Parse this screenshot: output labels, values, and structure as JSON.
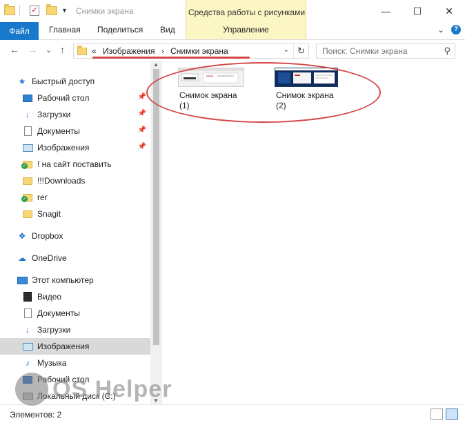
{
  "window": {
    "title": "Снимки экрана",
    "context_header": "Средства работы с рисунками",
    "minimize": "—",
    "maximize": "☐",
    "close": "✕"
  },
  "ribbon": {
    "tabs": {
      "file": "Файл",
      "home": "Главная",
      "share": "Поделиться",
      "view": "Вид",
      "manage": "Управление"
    }
  },
  "navigation": {
    "back": "←",
    "forward": "→",
    "recent": "⌄",
    "up": "↑",
    "address": {
      "overflow": "«",
      "crumb1": "Изображения",
      "separator": "›",
      "crumb2": "Снимки экрана"
    },
    "search_placeholder": "Поиск: Снимки экрана"
  },
  "sidebar": {
    "quick_access": "Быстрый доступ",
    "desktop": "Рабочий стол",
    "downloads": "Загрузки",
    "documents": "Документы",
    "pictures": "Изображения",
    "folder1": "! на сайт поставить",
    "folder2": "!!!Downloads",
    "folder3": "rer",
    "folder4": "Snagit",
    "dropbox": "Dropbox",
    "onedrive": "OneDrive",
    "this_pc": "Этот компьютер",
    "pc_video": "Видео",
    "pc_documents": "Документы",
    "pc_downloads": "Загрузки",
    "pc_pictures": "Изображения",
    "pc_music": "Музыка",
    "pc_desktop": "Рабочий стол",
    "pc_disk": "Локальный диск (C:)"
  },
  "files": [
    {
      "name": "Снимок экрана (1)"
    },
    {
      "name": "Снимок экрана (2)"
    }
  ],
  "status": {
    "count": "Элементов: 2"
  },
  "watermark": "OS Helper",
  "colors": {
    "accent": "#1979ca",
    "annotation": "#d64545",
    "context_tab": "#fcf6c4",
    "selected": "#d9d9d9"
  }
}
